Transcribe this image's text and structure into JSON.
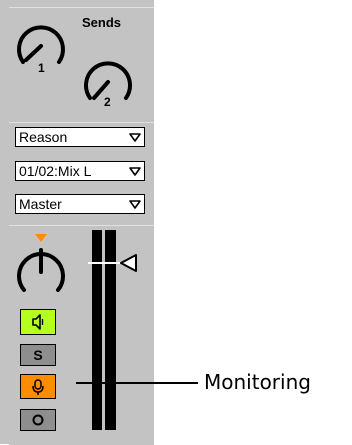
{
  "sends": {
    "label": "Sends",
    "knob_1_label": "1",
    "knob_2_label": "2"
  },
  "routing": {
    "input_type": "Reason",
    "input_channel": "01/02:Mix L",
    "output_type": "Master"
  },
  "mixer": {
    "speaker_button_color": "#b4ff1e",
    "solo_label": "S",
    "monitor_button_color": "#ff8c00",
    "pan_indicator_color": "#ff8c00"
  },
  "annotation": {
    "label": "Monitoring"
  }
}
